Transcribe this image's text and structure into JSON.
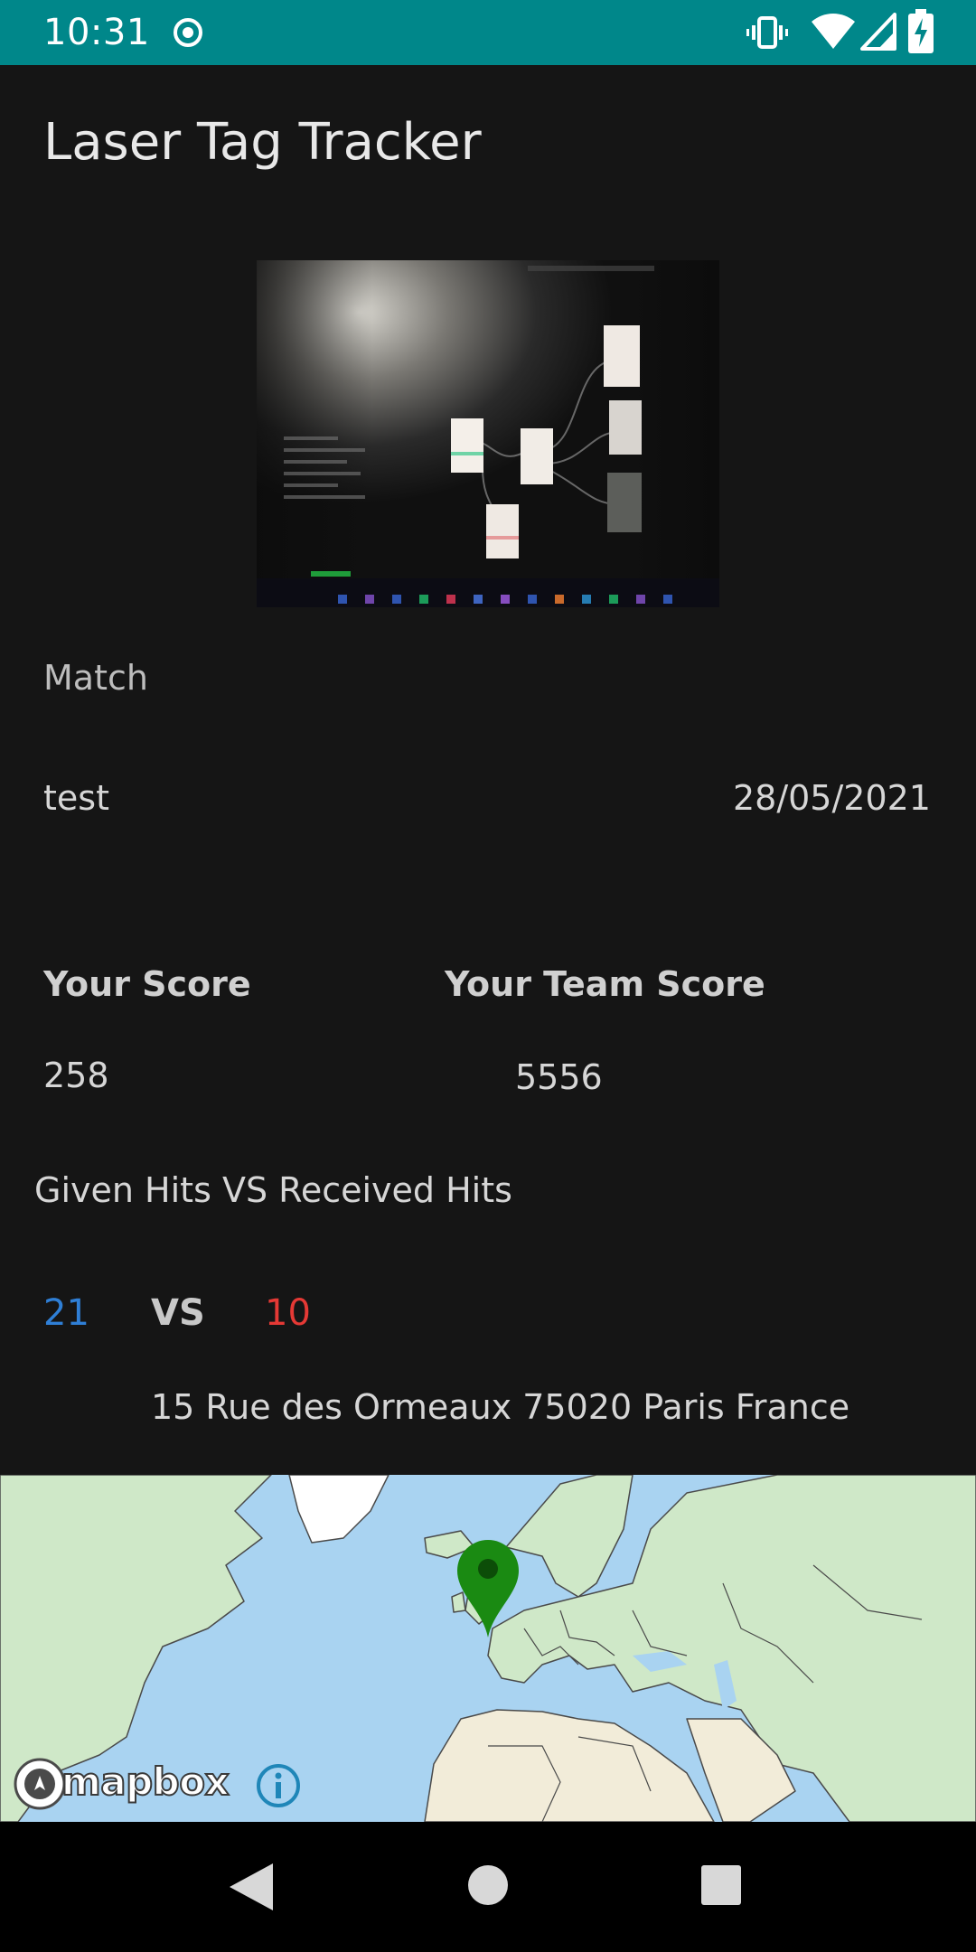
{
  "status_bar": {
    "time": "10:31",
    "icons": [
      "record-icon",
      "vibrate-icon",
      "wifi-icon",
      "signal-icon",
      "battery-charging-icon"
    ]
  },
  "app": {
    "title": "Laser Tag Tracker"
  },
  "match": {
    "section_label": "Match",
    "name": "test",
    "date": "28/05/2021"
  },
  "scores": {
    "your_score_label": "Your Score",
    "your_score_value": "258",
    "team_score_label": "Your Team Score",
    "team_score_value": "5556"
  },
  "hits": {
    "title": "Given Hits VS Received Hits",
    "given": "21",
    "vs_label": "VS",
    "received": "10",
    "given_color": "#2f7fd6",
    "received_color": "#e53935"
  },
  "location": {
    "address": "15 Rue des Ormeaux 75020 Paris France"
  },
  "map": {
    "provider_logo": "mapbox",
    "marker_color": "#1a8a12"
  },
  "colors": {
    "status_bar": "#00878a",
    "background": "#151515",
    "nav_bar": "#000000"
  }
}
